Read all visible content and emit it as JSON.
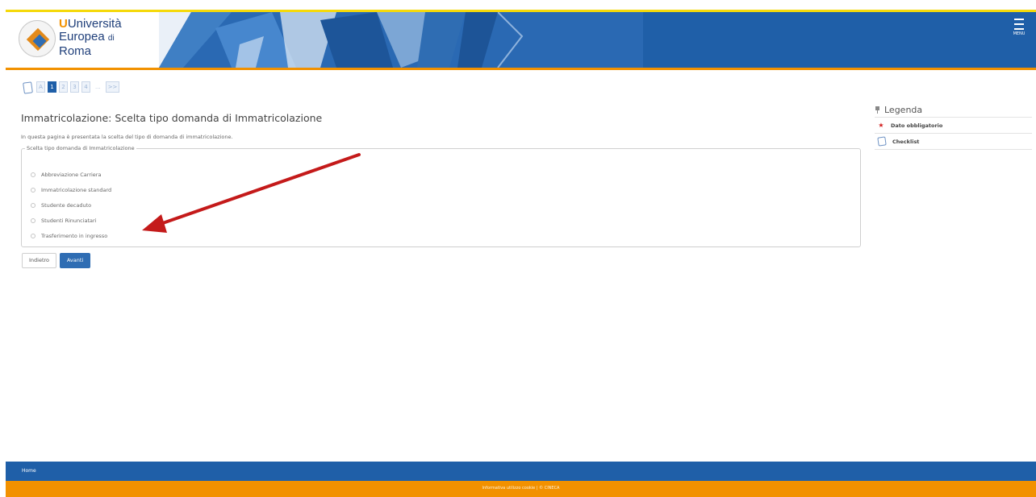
{
  "header": {
    "logo_line1": "Università",
    "logo_line2": "Europea",
    "logo_line2_suffix": "di",
    "logo_line3": "Roma",
    "menu_label": "MENU"
  },
  "steps": {
    "items": [
      "A",
      "1",
      "2",
      "3",
      "4",
      "...",
      ">>"
    ],
    "active_index": 1
  },
  "main": {
    "title": "Immatricolazione: Scelta tipo domanda di Immatricolazione",
    "intro": "In questa pagina è presentata la scelta del tipo di domanda di immatricolazione.",
    "fieldset_legend": "Scelta tipo domanda di Immatricolazione",
    "options": [
      "Abbreviazione Carriera",
      "Immatricolazione standard",
      "Studente decaduto",
      "Studenti Rinunciatari",
      "Trasferimento in ingresso"
    ],
    "back_label": "Indietro",
    "next_label": "Avanti"
  },
  "legend": {
    "title": "Legenda",
    "items": [
      {
        "icon": "required-star-icon",
        "label": "Dato obbligatorio"
      },
      {
        "icon": "checklist-icon",
        "label": "Checklist"
      }
    ]
  },
  "footer": {
    "home_link": "Home",
    "info": "Informativa utilizzo cookie | © CINECA"
  },
  "colors": {
    "primary_blue": "#1f5fa8",
    "accent_orange": "#f29100",
    "top_stripe_yellow": "#f5d90a",
    "annotation_red": "#c41a1a"
  }
}
